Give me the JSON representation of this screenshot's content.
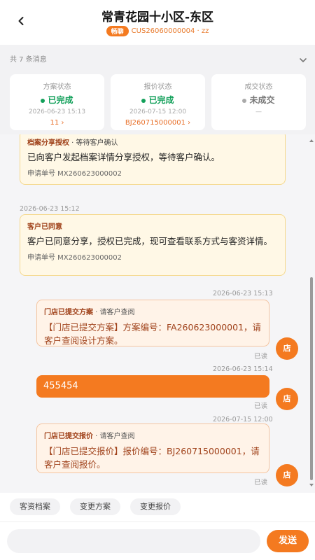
{
  "header": {
    "title": "常青花园十小区-东区",
    "tag": "畅聊",
    "customer_id": "CUS26060000004 · zz"
  },
  "summary": {
    "count_text": "共 7 条消息",
    "cards": [
      {
        "label": "方案状态",
        "status": "已完成",
        "date": "2026-06-23 15:13",
        "link": "11 ›"
      },
      {
        "label": "报价状态",
        "status": "已完成",
        "date": "2026-07-15 12:00",
        "link": "BJ260715000001 ›"
      },
      {
        "label": "成交状态",
        "status": "未成交",
        "date": "—"
      }
    ]
  },
  "messages": {
    "m1": {
      "head_title": "档案分享授权",
      "head_note": " · 等待客户确认",
      "body": "已向客户发起档案详情分享授权，等待客户确认。",
      "order_no": "申请单号 MX260623000002"
    },
    "m2": {
      "time": "2026-06-23 15:12",
      "head_title": "客户已同意",
      "body": "客户已同意分享，授权已完成，现可查看联系方式与客资详情。",
      "order_no": "申请单号 MX260623000002"
    },
    "m3": {
      "time": "2026-06-23 15:13",
      "head_title": "门店已提交方案",
      "head_note": " · 请客户查阅",
      "body": "【门店已提交方案】方案编号：FA260623000001，请客户查阅设计方案。",
      "read": "已读",
      "avatar": "店"
    },
    "m4": {
      "time": "2026-06-23 15:14",
      "body": "455454",
      "read": "已读",
      "avatar": "店"
    },
    "m5": {
      "time": "2026-07-15 12:00",
      "head_title": "门店已提交报价",
      "head_note": " · 请客户查阅",
      "body": "【门店已提交报价】报价编号：BJ260715000001，请客户查阅报价。",
      "read": "已读",
      "avatar": "店"
    }
  },
  "quick_actions": [
    "客资档案",
    "变更方案",
    "变更报价"
  ],
  "composer": {
    "placeholder": "",
    "send_label": "发送"
  },
  "colors": {
    "accent": "#f47a20",
    "success": "#12a05a",
    "notice_bg": "#fff8e6",
    "message_bg": "#fff3e8"
  }
}
